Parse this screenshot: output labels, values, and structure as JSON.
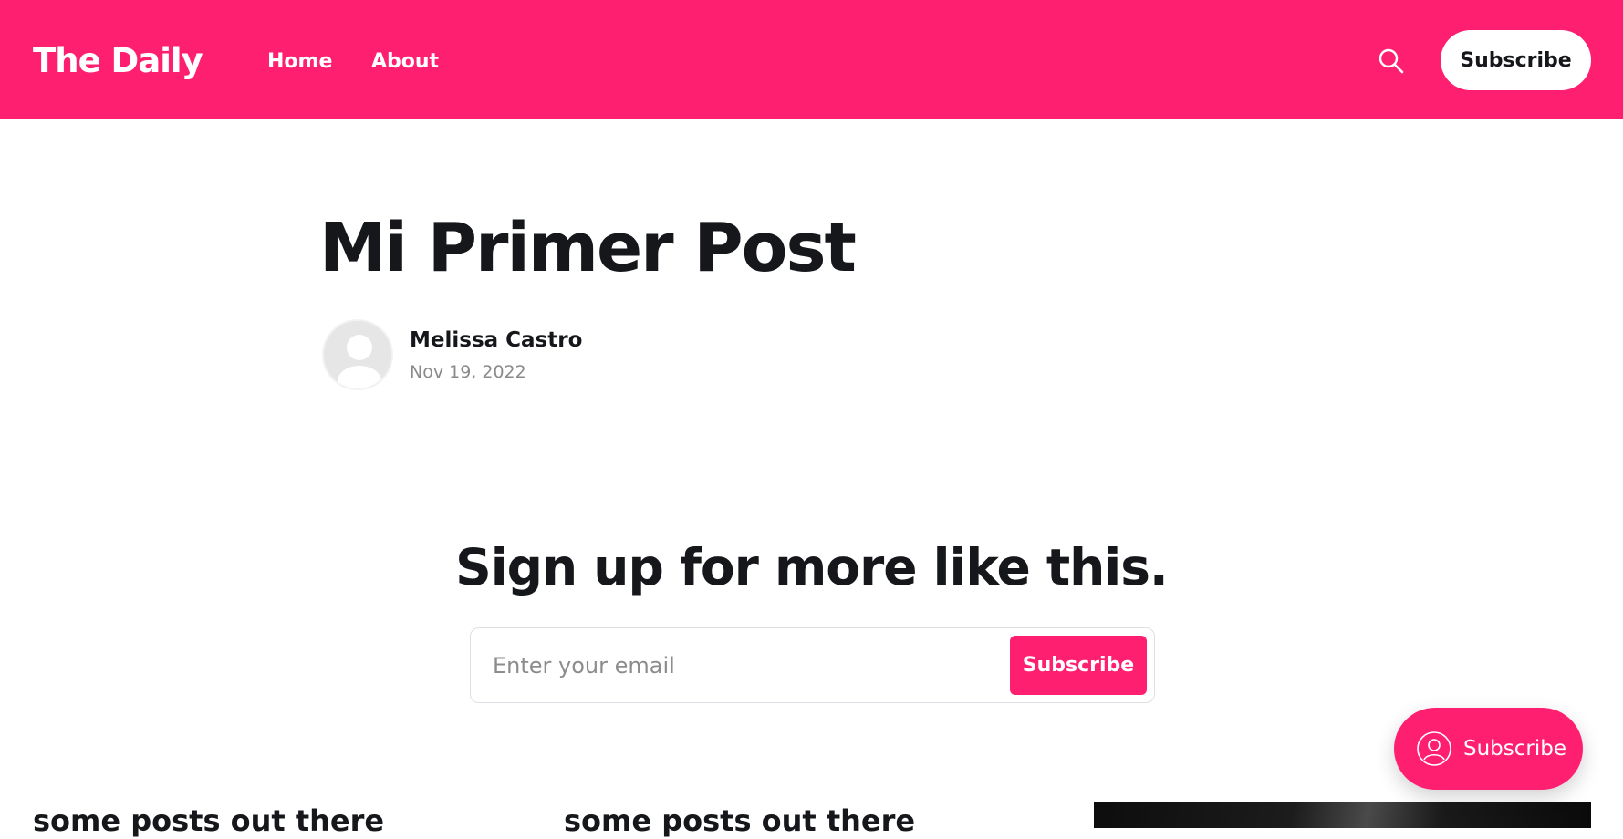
{
  "header": {
    "logo": "The Daily",
    "nav": [
      {
        "label": "Home"
      },
      {
        "label": "About"
      }
    ],
    "search_icon": "search-icon",
    "subscribe_label": "Subscribe"
  },
  "post": {
    "title": "Mi Primer Post",
    "author": "Melissa Castro",
    "date": "Nov 19, 2022",
    "avatar_icon": "user-avatar-icon"
  },
  "cta": {
    "title": "Sign up for more like this.",
    "email_placeholder": "Enter your email",
    "email_value": "",
    "submit_label": "Subscribe"
  },
  "portal": {
    "label": "Subscribe",
    "icon": "user-circle-icon"
  },
  "feed": [
    {
      "title": "some posts out there"
    },
    {
      "title": "some posts out there"
    }
  ],
  "colors": {
    "accent": "#ff1f71",
    "text": "#15171a",
    "muted": "#8a8a8a",
    "background": "#ffffff"
  }
}
